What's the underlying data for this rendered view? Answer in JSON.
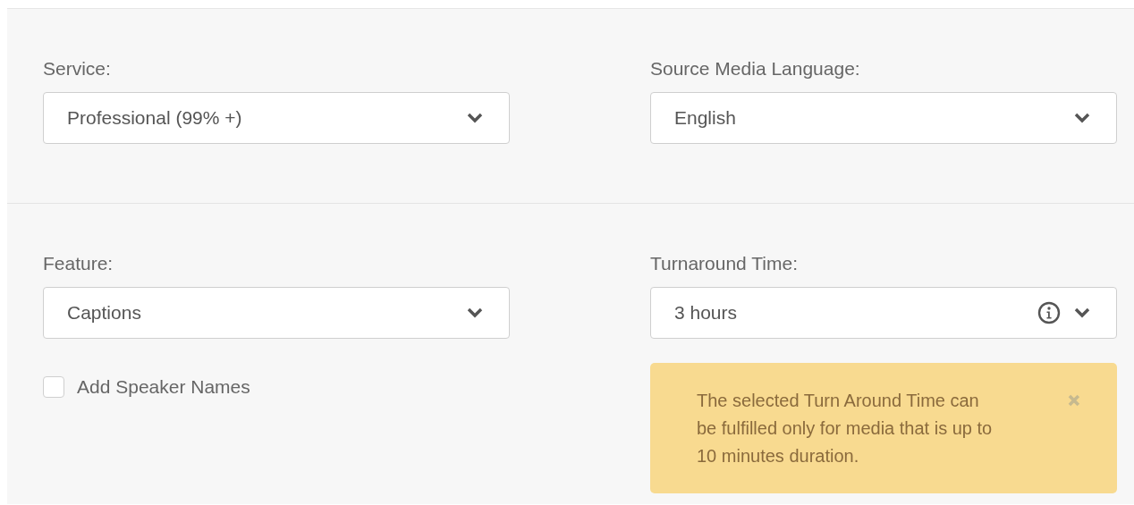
{
  "sections": [
    {
      "fields": [
        {
          "label": "Service:",
          "value": "Professional (99% +)",
          "info": false
        },
        {
          "label": "Source Media Language:",
          "value": "English",
          "info": false
        }
      ]
    },
    {
      "fields": [
        {
          "label": "Feature:",
          "value": "Captions",
          "info": false,
          "options": [
            {
              "kind": "checkbox",
              "label": "Add Speaker Names",
              "checked": false
            }
          ]
        },
        {
          "label": "Turnaround Time:",
          "value": "3 hours",
          "info": true,
          "alert": {
            "text": "The selected Turn Around Time can be fulfilled only for media that is up to 10 minutes duration."
          }
        }
      ]
    }
  ]
}
